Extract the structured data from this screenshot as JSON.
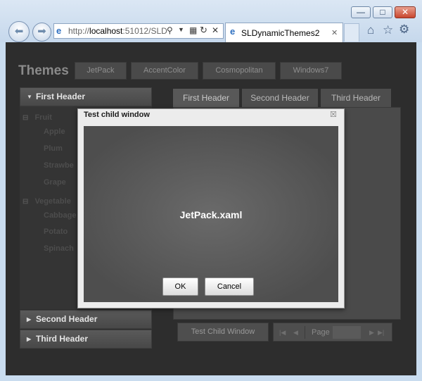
{
  "browser": {
    "url_prefix": "http://",
    "url_host": "localhost",
    "url_rest": ":51012/SLD",
    "tab_title": "SLDynamicThemes2",
    "tab_close": "✕",
    "win_min": "—",
    "win_max": "□",
    "win_close": "✕"
  },
  "app": {
    "title": "Themes",
    "theme_buttons": [
      "JetPack",
      "AccentColor",
      "Cosmopolitan",
      "Windows7"
    ],
    "accordion": {
      "first": "First Header",
      "second": "Second Header",
      "third": "Third Header"
    },
    "tree": {
      "fruit": "Fruit",
      "fruit_items": [
        "Apple",
        "Plum",
        "Strawbe",
        "Grape"
      ],
      "vegetables": "Vegetable",
      "vegetable_items": [
        "Cabbage",
        "Potato",
        "Spinach"
      ]
    },
    "tabs": [
      "First Header",
      "Second Header",
      "Third Header"
    ],
    "test_button": "Test Child Window",
    "pager": {
      "label": "Page"
    }
  },
  "modal": {
    "title": "Test child window",
    "close": "☒",
    "message": "JetPack.xaml",
    "ok": "OK",
    "cancel": "Cancel"
  }
}
